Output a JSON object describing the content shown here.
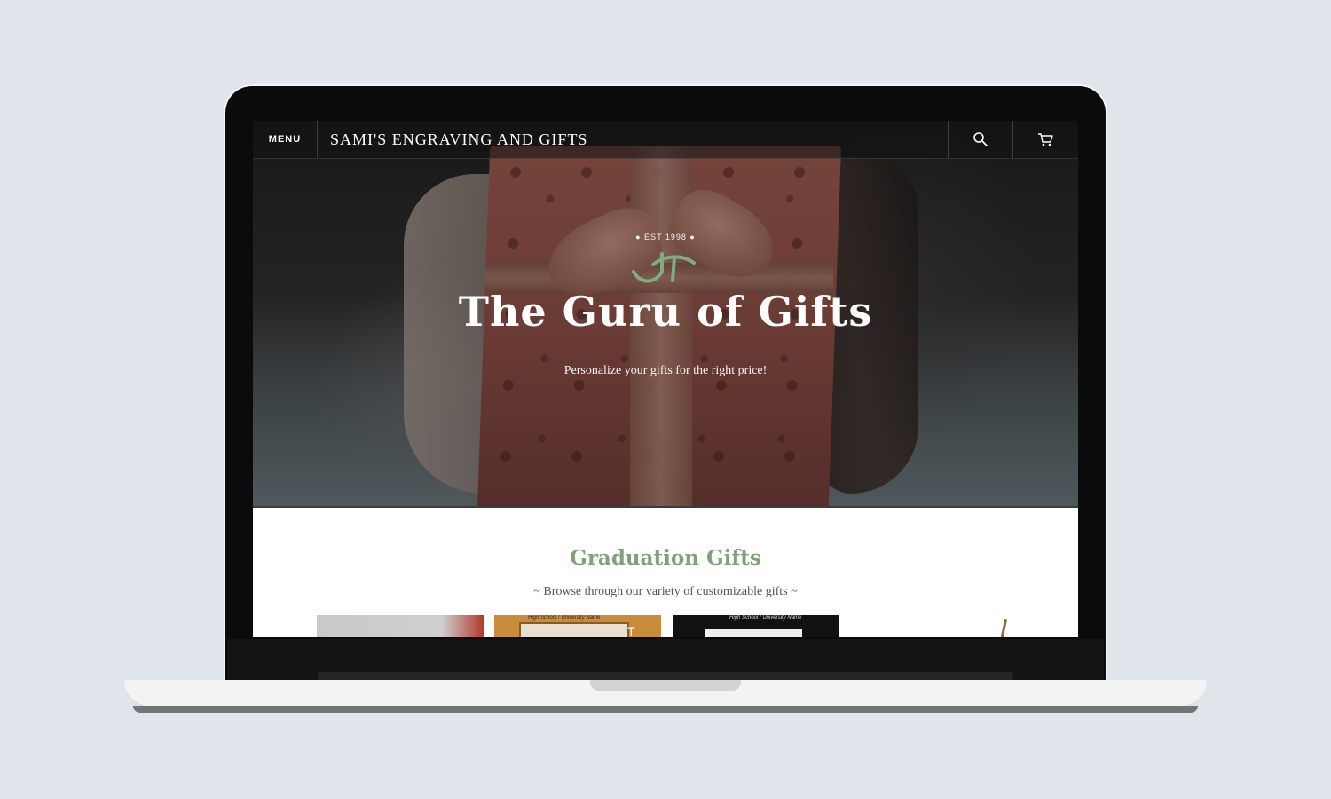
{
  "nav": {
    "menu_label": "MENU",
    "site_title": "SAMI'S ENGRAVING AND GIFTS",
    "search_icon": "search-icon",
    "cart_icon": "cart-icon"
  },
  "hero": {
    "established": "● EST 1998 ●",
    "title": "The Guru of Gifts",
    "subtitle": "Personalize your gifts for the right price!"
  },
  "section": {
    "title": "Graduation Gifts",
    "subtitle": "~  Browse through our variety of customizable gifts ~"
  },
  "products": [
    {
      "caption": ""
    },
    {
      "caption": "High School / University Name",
      "letter": "T"
    },
    {
      "caption": "High School / University Name"
    },
    {
      "caption": ""
    }
  ],
  "colors": {
    "accent_green": "#83a07e",
    "page_background": "#e0e5ec"
  }
}
